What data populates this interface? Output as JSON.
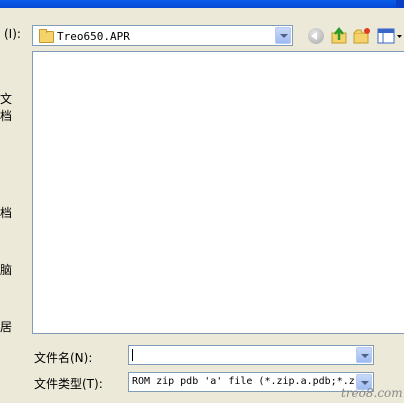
{
  "dialog": {
    "look_in_label": "(I):",
    "look_in_value": "Treo650.APR"
  },
  "sidebar": {
    "items": [
      "文档",
      "档",
      "脑",
      "居"
    ]
  },
  "fields": {
    "filename_label": "文件名(N):",
    "filename_value": "",
    "filetype_label": "文件类型(T):",
    "filetype_value": "ROM zip pdb 'a' file (*.zip.a.pdb;*.z"
  },
  "watermark": "treo8.com",
  "colors": {
    "border": "#7f9db9",
    "dialog_bg": "#ece9d8",
    "titlebar": "#0a5ce8"
  },
  "icons": [
    "folder-icon",
    "chevron-down-icon",
    "back-icon",
    "up-folder-icon",
    "new-folder-icon",
    "view-menu-icon"
  ]
}
